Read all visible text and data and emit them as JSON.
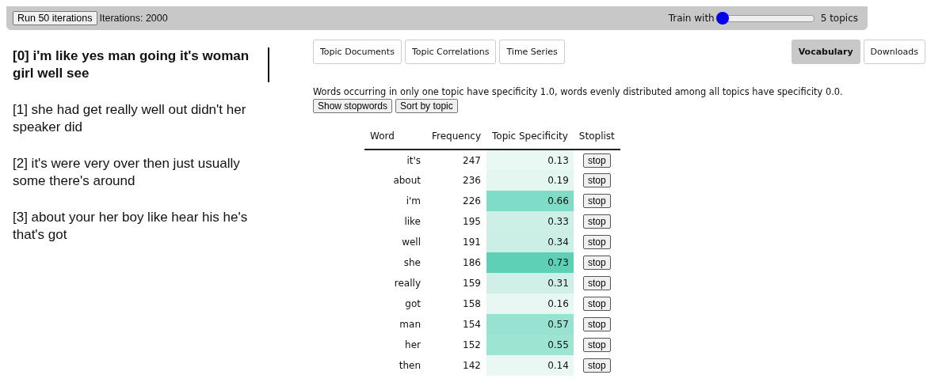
{
  "toolbar": {
    "run_button": "Run 50 iterations",
    "iterations": "Iterations: 2000",
    "train_label": "Train with",
    "topics_slider": {
      "level": 0.0
    },
    "topics_count": "5 topics"
  },
  "topics": [
    {
      "label": "[0] i'm like yes man going it's woman girl well see",
      "selected": true
    },
    {
      "label": "[1] she had get really well out didn't her speaker did",
      "selected": false
    },
    {
      "label": "[2] it's were very over then just usually some there's around",
      "selected": false
    },
    {
      "label": "[3] about your her boy like hear his he's that's got",
      "selected": false
    }
  ],
  "tabs": [
    {
      "label": "Topic Documents",
      "selected": false
    },
    {
      "label": "Topic Correlations",
      "selected": false
    },
    {
      "label": "Time Series",
      "selected": false
    }
  ],
  "view_tabs": [
    {
      "label": "Vocabulary",
      "selected": true
    },
    {
      "label": "Downloads",
      "selected": false
    }
  ],
  "description": "Words occurring in only one topic have specificity 1.0, words evenly distributed among all topics have specificity 0.0.",
  "buttons": [
    "Show stopwords",
    "Sort by topic"
  ],
  "table": {
    "columns": [
      "Word",
      "Frequency",
      "Topic Specificity",
      "Stoplist"
    ],
    "rows": [
      {
        "word": "it's",
        "frequency": "247",
        "specificity": "0.13",
        "color": "#eaf8f4",
        "stop": "stop"
      },
      {
        "word": "about",
        "frequency": "236",
        "specificity": "0.19",
        "color": "#e4f6f0",
        "stop": "stop"
      },
      {
        "word": "i'm",
        "frequency": "226",
        "specificity": "0.66",
        "color": "#7fdcc6",
        "stop": "stop"
      },
      {
        "word": "like",
        "frequency": "195",
        "specificity": "0.33",
        "color": "#cdefe6",
        "stop": "stop"
      },
      {
        "word": "well",
        "frequency": "191",
        "specificity": "0.34",
        "color": "#ccefe5",
        "stop": "stop"
      },
      {
        "word": "she",
        "frequency": "186",
        "specificity": "0.73",
        "color": "#5dd0b6",
        "stop": "stop"
      },
      {
        "word": "really",
        "frequency": "159",
        "specificity": "0.31",
        "color": "#d0f0e7",
        "stop": "stop"
      },
      {
        "word": "got",
        "frequency": "158",
        "specificity": "0.16",
        "color": "#e8f7f2",
        "stop": "stop"
      },
      {
        "word": "man",
        "frequency": "154",
        "specificity": "0.57",
        "color": "#97e2d0",
        "stop": "stop"
      },
      {
        "word": "her",
        "frequency": "152",
        "specificity": "0.55",
        "color": "#9de4d2",
        "stop": "stop"
      },
      {
        "word": "then",
        "frequency": "142",
        "specificity": "0.14",
        "color": "#e9f8f3",
        "stop": "stop"
      }
    ]
  }
}
